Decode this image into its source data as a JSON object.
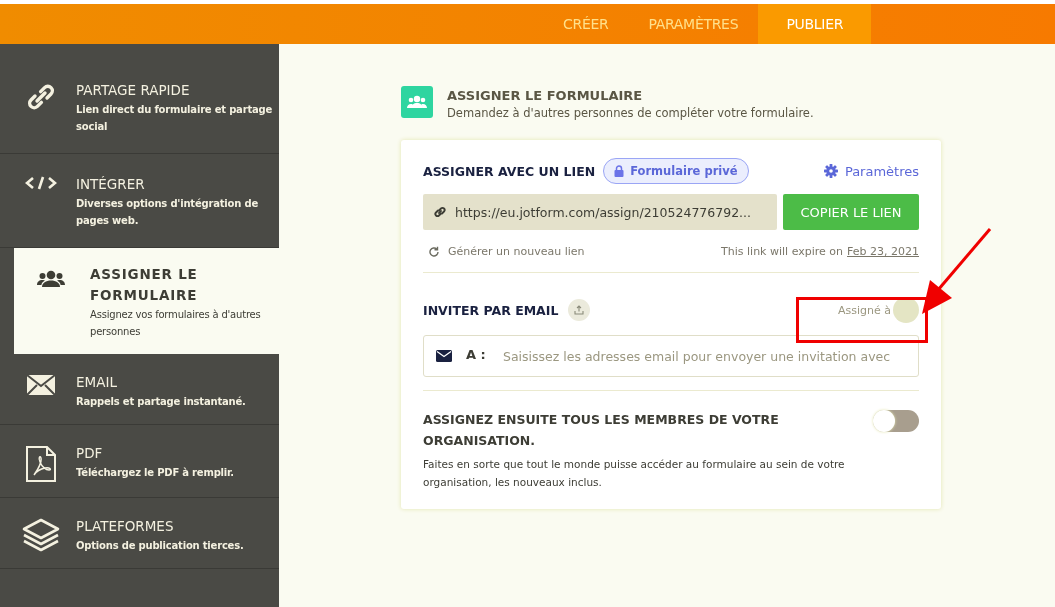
{
  "top_nav": [
    {
      "label": "CRÉER",
      "selected": false
    },
    {
      "label": "PARAMÈTRES",
      "selected": false
    },
    {
      "label": "PUBLIER",
      "selected": true
    }
  ],
  "sidebar": {
    "items": [
      {
        "kind": "link",
        "title": "PARTAGE RAPIDE",
        "subtitle": "Lien direct du formulaire et partage social",
        "selected": false
      },
      {
        "kind": "code",
        "title": "INTÉGRER",
        "subtitle": "Diverses options d'intégration de pages web.",
        "selected": false
      },
      {
        "kind": "people",
        "title": "ASSIGNER LE FORMULAIRE",
        "subtitle": "Assignez vos formulaires à d'autres personnes",
        "selected": true
      },
      {
        "kind": "mail",
        "title": "EMAIL",
        "subtitle": "Rappels et partage instantané.",
        "selected": false
      },
      {
        "kind": "pdf",
        "title": "PDF",
        "subtitle": "Téléchargez le PDF à remplir.",
        "selected": false
      },
      {
        "kind": "layers",
        "title": "PLATEFORMES",
        "subtitle": "Options de publication tierces.",
        "selected": false
      }
    ]
  },
  "header": {
    "title": "ASSIGNER LE FORMULAIRE",
    "subtitle": "Demandez à d'autres personnes de compléter votre formulaire."
  },
  "link_section": {
    "title": "ASSIGNER AVEC UN LIEN",
    "badge": "Formulaire privé",
    "settings": "Paramètres",
    "url": "https://eu.jotform.com/assign/210524776792...",
    "copy_button": "COPIER LE LIEN",
    "regenerate": "Générer un nouveau lien",
    "expiry_text": "This link will expire on",
    "expiry_date": "Feb 23, 2021"
  },
  "email_section": {
    "title": "INVITER PAR EMAIL",
    "assigned_label": "Assigné à",
    "to_label": "A :",
    "placeholder": "Saisissez les adresses email pour envoyer une invitation avec"
  },
  "org_section": {
    "title": "ASSIGNEZ ENSUITE TOUS LES MEMBRES DE VOTRE ORGANISATION.",
    "description": "Faites en sorte que tout le monde puisse accéder au formulaire au sein de votre organisation, les nouveaux inclus.",
    "on": false
  }
}
